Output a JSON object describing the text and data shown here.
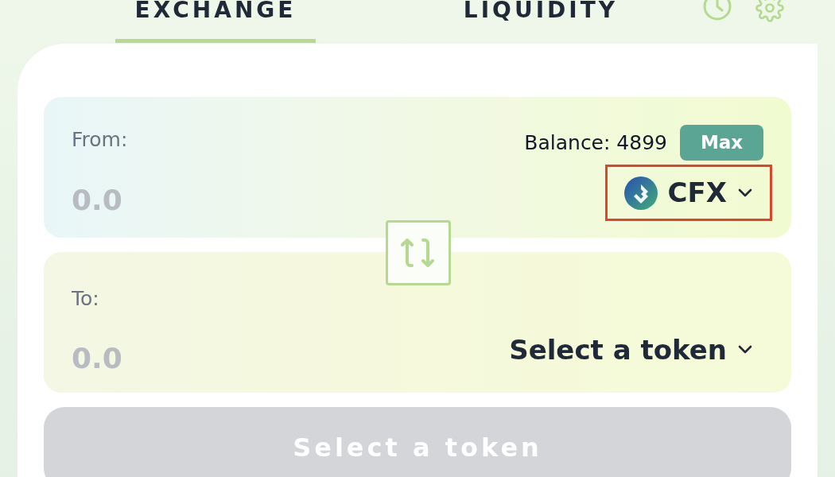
{
  "tabs": [
    {
      "label": "EXCHANGE",
      "selected": true
    },
    {
      "label": "LIQUIDITY",
      "selected": false
    }
  ],
  "from": {
    "label": "From:",
    "placeholder": "0.0",
    "balance": "Balance: 4899",
    "max_button": "Max",
    "token": {
      "symbol": "CFX",
      "highlighted": true
    }
  },
  "to": {
    "label": "To:",
    "placeholder": "0.0",
    "token": {
      "symbol": "Select a token",
      "highlighted": false
    }
  },
  "submit": {
    "label": "Select a token",
    "disabled": true
  }
}
